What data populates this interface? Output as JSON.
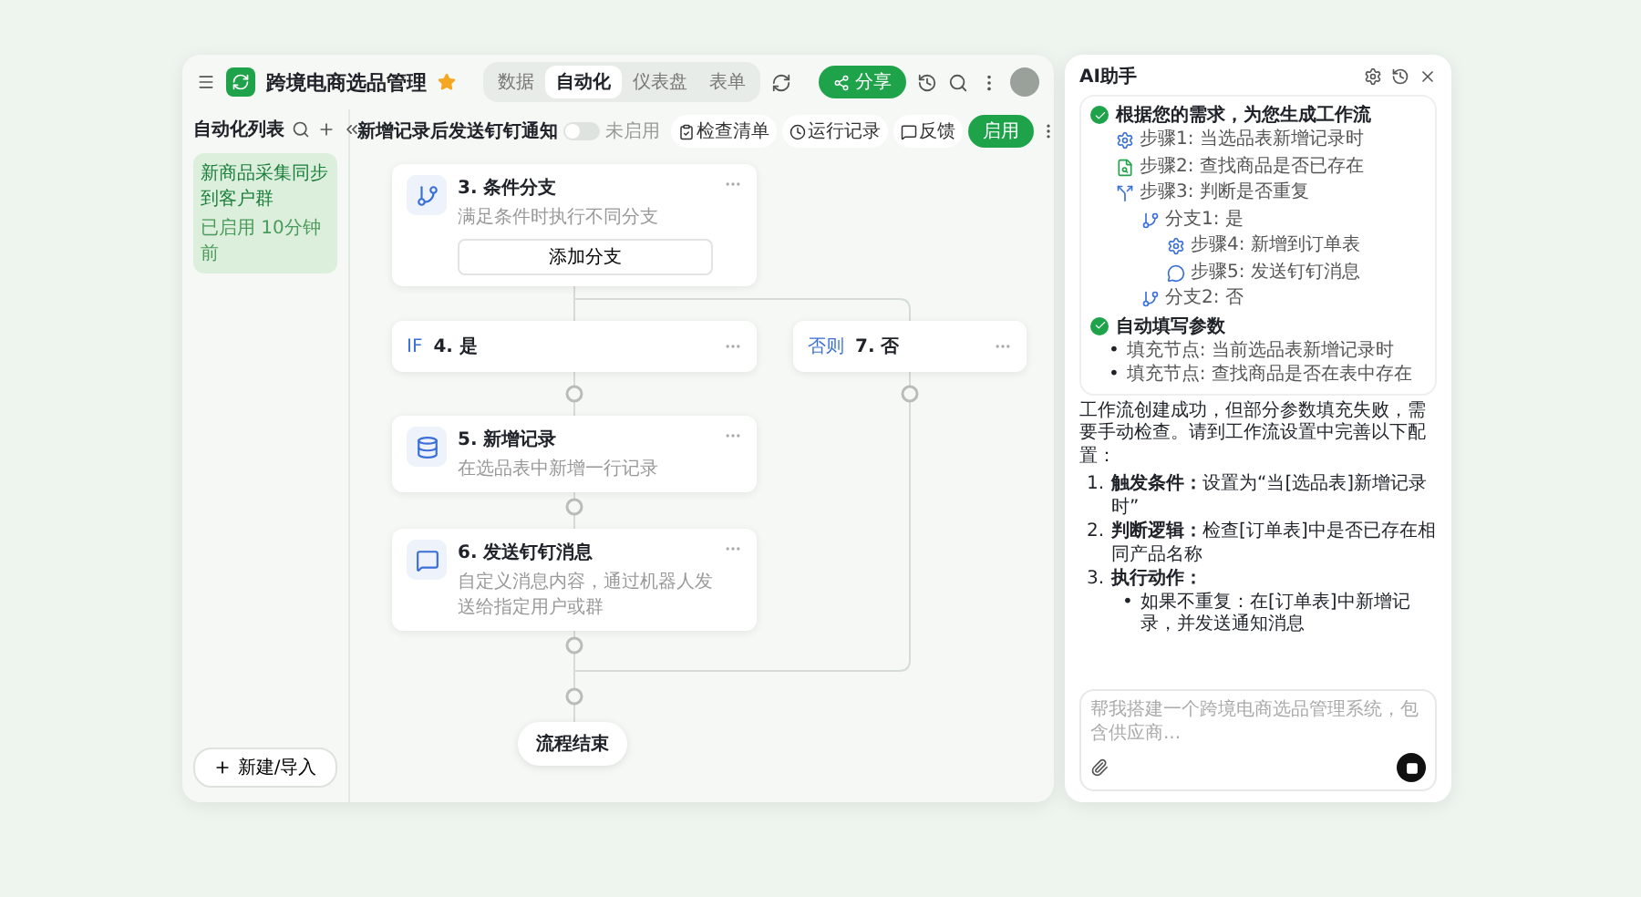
{
  "header": {
    "title": "跨境电商选品管理",
    "starred": true,
    "tabs": [
      {
        "label": "数据",
        "selected": false
      },
      {
        "label": "自动化",
        "selected": true
      },
      {
        "label": "仪表盘",
        "selected": false
      },
      {
        "label": "表单",
        "selected": false
      }
    ],
    "share_button": "分享"
  },
  "sidebar": {
    "title": "自动化列表",
    "items": [
      {
        "title": "新商品采集同步到客户群",
        "meta": "已启用 10分钟前",
        "selected": true
      }
    ],
    "new_button": "新建/导入"
  },
  "toolbar": {
    "title": "新增记录后发送钉钉通知",
    "toggle": {
      "label": "未启用",
      "on": false
    },
    "buttons": [
      "检查清单",
      "运行记录",
      "反馈"
    ],
    "primary_button": "启用"
  },
  "nodes": [
    {
      "kind": "branch",
      "title": "3. 条件分支",
      "description": "满足条件时执行不同分支",
      "button": "添加分支"
    },
    {
      "kind": "condition",
      "tag": "IF",
      "title": "4. 是"
    },
    {
      "kind": "condition",
      "tag": "否则",
      "title": "7. 否"
    },
    {
      "kind": "record",
      "title": "5. 新增记录",
      "description": "在选品表中新增一行记录"
    },
    {
      "kind": "message",
      "title": "6. 发送钉钉消息",
      "description": "自定义消息内容，通过机器人发送给指定用户或群"
    },
    {
      "kind": "end",
      "title": "流程结束"
    }
  ],
  "assistant": {
    "title": "AI助手",
    "plan": {
      "title": "根据您的需求，为您生成工作流",
      "done": true,
      "steps": [
        {
          "kind": "trigger",
          "text": "步骤1: 当选品表新增记录时"
        },
        {
          "kind": "search",
          "text": "步骤2: 查找商品是否已存在"
        },
        {
          "kind": "condition",
          "text": "步骤3: 判断是否重复",
          "children": [
            {
              "kind": "branch",
              "text": "分支1: 是",
              "children": [
                {
                  "kind": "trigger",
                  "text": "步骤4: 新增到订单表"
                },
                {
                  "kind": "message",
                  "text": "步骤5: 发送钉钉消息"
                }
              ]
            },
            {
              "kind": "branch",
              "text": "分支2: 否"
            }
          ]
        }
      ]
    },
    "params": {
      "title": "自动填写参数",
      "done": true,
      "items": [
        {
          "marker": "•",
          "text": "填充节点: 当前选品表新增记录时"
        },
        {
          "marker": "•",
          "text": "填充节点: 查找商品是否在表中存在"
        }
      ]
    },
    "message": "工作流创建成功，但部分参数填充失败，需要手动检查。请到工作流设置中完善以下配置：",
    "list": [
      {
        "marker": "1.",
        "text": "**触发条件：**设置为“当[选品表]新增记录时”"
      },
      {
        "marker": "2.",
        "text": "**判断逻辑：**检查[订单表]中是否已存在相同产品名称"
      },
      {
        "marker": "3.",
        "text": "**执行动作：**",
        "children": [
          {
            "marker": "•",
            "text": "如果不重复：在[订单表]中新增记录，并发送通知消息"
          }
        ]
      }
    ],
    "input": {
      "placeholder": "帮我搭建一个跨境电商选品管理系统，包含供应商..."
    }
  }
}
